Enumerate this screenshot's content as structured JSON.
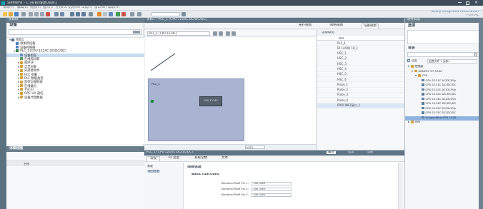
{
  "app": {
    "title": "Siemens - C:\\项目\\博途\\项目1",
    "brand_line1": "Totally Integrated Automation",
    "brand_line2": "PORTAL"
  },
  "menu": [
    "项目(P)",
    "编辑(E)",
    "视图(V)",
    "插入(I)",
    "在线(O)",
    "选项(N)",
    "工具(T)",
    "窗口(W)",
    "帮助(H)"
  ],
  "project_tree": {
    "header": "项目树",
    "title": "设备",
    "items": [
      {
        "label": "项目1",
        "indent": 0,
        "tw": "▾",
        "color": "#4a6b8c"
      },
      {
        "label": "添加新设备",
        "indent": 1,
        "tw": "",
        "color": "#4a7fc1"
      },
      {
        "label": "设备和网络",
        "indent": 1,
        "tw": "",
        "color": "#4a7fc1"
      },
      {
        "label": "PLC_1 [CPU 1214C DC/DC/DC]",
        "indent": 1,
        "tw": "▾",
        "color": "#2f7e47"
      },
      {
        "label": "设备组态",
        "indent": 2,
        "tw": "",
        "color": "#6a8fb9",
        "selected": true
      },
      {
        "label": "在线和诊断",
        "indent": 2,
        "tw": "",
        "color": "#5f9b5a"
      },
      {
        "label": "程序块",
        "indent": 2,
        "tw": "▸",
        "color": "#d2a33d"
      },
      {
        "label": "工艺对象",
        "indent": 2,
        "tw": "▸",
        "color": "#d2a33d"
      },
      {
        "label": "外部源文件",
        "indent": 2,
        "tw": "▸",
        "color": "#d2a33d"
      },
      {
        "label": "PLC 变量",
        "indent": 2,
        "tw": "▸",
        "color": "#d2a33d"
      },
      {
        "label": "PLC 数据类型",
        "indent": 2,
        "tw": "▸",
        "color": "#d2a33d"
      },
      {
        "label": "监控与强制表",
        "indent": 2,
        "tw": "▸",
        "color": "#d2a33d"
      },
      {
        "label": "在线备份",
        "indent": 2,
        "tw": "▸",
        "color": "#d2a33d"
      },
      {
        "label": "Traces",
        "indent": 2,
        "tw": "▸",
        "color": "#d2a33d"
      },
      {
        "label": "OPC UA 通信",
        "indent": 2,
        "tw": "▸",
        "color": "#d2a33d"
      },
      {
        "label": "设备代理数据",
        "indent": 2,
        "tw": "▸",
        "color": "#d2a33d"
      }
    ],
    "details_header": "详细视图",
    "details_col": "名称"
  },
  "editor": {
    "breadcrumb": "项目1 › PLC_1 [CPU 1214C DC/DC/DC]",
    "view_tabs": [
      "拓扑视图",
      "网络视图",
      "设备视图"
    ],
    "active_view": 2,
    "device_dropdown": "PLC_1 [CPU 1214C]",
    "rack_label_1": "PLC_1",
    "rack_label_2": "",
    "module_label": "CPU 1214C",
    "zoom": "100%"
  },
  "overview": {
    "tab": "设备概览",
    "col_module": "模块",
    "rows": [
      {
        "label": "PLC_1",
        "selected": false
      },
      {
        "label": "DI 14/DQ 10_1",
        "selected": false
      },
      {
        "label": "HSC_1",
        "selected": false
      },
      {
        "label": "HSC_2",
        "selected": false
      },
      {
        "label": "HSC_3",
        "selected": false
      },
      {
        "label": "HSC_4",
        "selected": false
      },
      {
        "label": "HSC_5",
        "selected": false
      },
      {
        "label": "HSC_6",
        "selected": false
      },
      {
        "label": "Pulse_1",
        "selected": false
      },
      {
        "label": "Pulse_2",
        "selected": false
      },
      {
        "label": "Pulse_3",
        "selected": false
      },
      {
        "label": "Pulse_4",
        "selected": false
      },
      {
        "label": "PROFINET接口_1",
        "selected": true
      }
    ]
  },
  "properties": {
    "header": "PLC_1 [CPU 1214C DC/DC/DC]",
    "header_tabs": [
      "属性",
      "信息",
      "诊断"
    ],
    "tabs": [
      "常规",
      "IO 变量",
      "系统常数",
      "文本"
    ],
    "active_tab": 0,
    "nav_items": [
      "常规",
      "项目信息"
    ],
    "section_title": "项目信息",
    "subsection": "Basic functions",
    "fields": [
      {
        "label": "Standard RAM Pin 1:",
        "value": "Not used"
      },
      {
        "label": "Standard RAM Pin 2:",
        "value": "Not used"
      },
      {
        "label": "Standard RAM Pin 3:",
        "value": "Not used"
      }
    ]
  },
  "catalog": {
    "header": "硬件目录",
    "options_title": "选项",
    "catalog_title": "目录",
    "filter_label": "过滤",
    "profile_label": "配置文件 <全部>",
    "items": [
      {
        "label": "控制器",
        "indent": 0,
        "tw": "▾",
        "selected": false
      },
      {
        "label": "SIMATIC S7-1200",
        "indent": 1,
        "tw": "▾",
        "selected": false
      },
      {
        "label": "CPU",
        "indent": 2,
        "tw": "▾",
        "selected": false
      },
      {
        "label": "CPU 1211C AC/DC/Rly",
        "indent": 3,
        "tw": "",
        "selected": false
      },
      {
        "label": "CPU 1211C DC/DC/DC",
        "indent": 3,
        "tw": "",
        "selected": false
      },
      {
        "label": "CPU 1212C AC/DC/Rly",
        "indent": 3,
        "tw": "",
        "selected": false
      },
      {
        "label": "CPU 1212C DC/DC/DC",
        "indent": 3,
        "tw": "",
        "selected": false
      },
      {
        "label": "CPU 1214C AC/DC/Rly",
        "indent": 3,
        "tw": "",
        "selected": false
      },
      {
        "label": "CPU 1214C DC/DC/DC",
        "indent": 3,
        "tw": "",
        "selected": false
      },
      {
        "label": "CPU 1215C AC/DC/Rly",
        "indent": 3,
        "tw": "",
        "selected": false
      },
      {
        "label": "CPU 1215C DC/DC/DC",
        "indent": 3,
        "tw": "",
        "selected": false
      },
      {
        "label": "Unspecified CPU 1200",
        "indent": 3,
        "tw": "",
        "selected": true
      },
      {
        "label": "HMI",
        "indent": 0,
        "tw": "▸",
        "selected": false
      }
    ]
  },
  "colors": {
    "title_bar": "#3e4c5c",
    "panel_header": "#6a7e8c",
    "rack": "#a9b3d2",
    "selection": "#c7dcf2"
  }
}
